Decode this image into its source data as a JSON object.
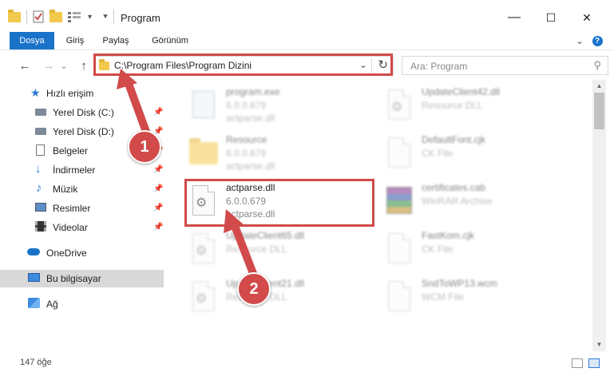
{
  "window": {
    "title": "Program",
    "minimize": "—",
    "maximize": "☐",
    "close": "✕",
    "help": "?",
    "ribbon_toggle": "⌄"
  },
  "ribbon": {
    "tabs": [
      {
        "label": "Dosya",
        "active": true
      },
      {
        "label": "Giriş"
      },
      {
        "label": "Paylaş"
      },
      {
        "label": "Görünüm"
      }
    ]
  },
  "nav": {
    "back": "←",
    "forward": "→",
    "recent": "⌄",
    "up": "↑",
    "address_path": "C:\\Program Files\\Program Dizini",
    "address_dropdown": "⌄",
    "refresh": "↻",
    "search_placeholder": "Ara: Program",
    "search_icon": "⚲"
  },
  "sidebar": {
    "items": [
      {
        "label": "Hızlı erişim",
        "icon": "star-icon"
      },
      {
        "label": "Yerel Disk (C:)",
        "icon": "drive-icon",
        "pinned": true
      },
      {
        "label": "Yerel Disk (D:)",
        "icon": "drive-icon",
        "pinned": true
      },
      {
        "label": "Belgeler",
        "icon": "documents-icon",
        "pinned": true
      },
      {
        "label": "İndirmeler",
        "icon": "download-icon",
        "pinned": true
      },
      {
        "label": "Müzik",
        "icon": "music-icon",
        "pinned": true
      },
      {
        "label": "Resimler",
        "icon": "pictures-icon",
        "pinned": true
      },
      {
        "label": "Videolar",
        "icon": "video-icon",
        "pinned": true
      },
      {
        "label": "OneDrive",
        "icon": "cloud-icon"
      },
      {
        "label": "Bu bilgisayar",
        "icon": "computer-icon",
        "selected": true
      },
      {
        "label": "Ağ",
        "icon": "network-icon"
      }
    ],
    "pin_glyph": "📌"
  },
  "files": [
    {
      "name": "program.exe",
      "line1": "6.0.0.679",
      "line2": "actparse.dll",
      "icon": "exe-icon",
      "blurred": true
    },
    {
      "name": "UpdateClient42.dll",
      "line1": "Resource DLL",
      "line2": "",
      "icon": "dll-icon",
      "blurred": true
    },
    {
      "name": "Resource",
      "line1": "6.0.0.679",
      "line2": "actparse.dll",
      "icon": "folder-icon",
      "blurred": true
    },
    {
      "name": "DefaultFont.cjk",
      "line1": "CK File",
      "line2": "",
      "icon": "file-icon",
      "blurred": true
    },
    {
      "name": "actparse.dll",
      "line1": "6.0.0.679",
      "line2": "actparse.dll",
      "icon": "dll-icon",
      "blurred": false
    },
    {
      "name": "certificates.cab",
      "line1": "WinRAR Archive",
      "line2": "",
      "icon": "rar-icon",
      "blurred": true
    },
    {
      "name": "UpdateClient65.dll",
      "line1": "Resource DLL",
      "line2": "",
      "icon": "dll-icon",
      "blurred": true
    },
    {
      "name": "FastKom.cjk",
      "line1": "CK File",
      "line2": "",
      "icon": "file-icon",
      "blurred": true
    },
    {
      "name": "UpdateClient21.dll",
      "line1": "Resource DLL",
      "line2": "",
      "icon": "dll-icon",
      "blurred": true
    },
    {
      "name": "SndToWP13.wcm",
      "line1": "WCM File",
      "line2": "",
      "icon": "file-icon",
      "blurred": true
    }
  ],
  "status": {
    "item_count": "147 öğe"
  },
  "callouts": {
    "one": "1",
    "two": "2"
  },
  "colors": {
    "accent": "#1a73c9",
    "highlight": "#d24a4a"
  }
}
